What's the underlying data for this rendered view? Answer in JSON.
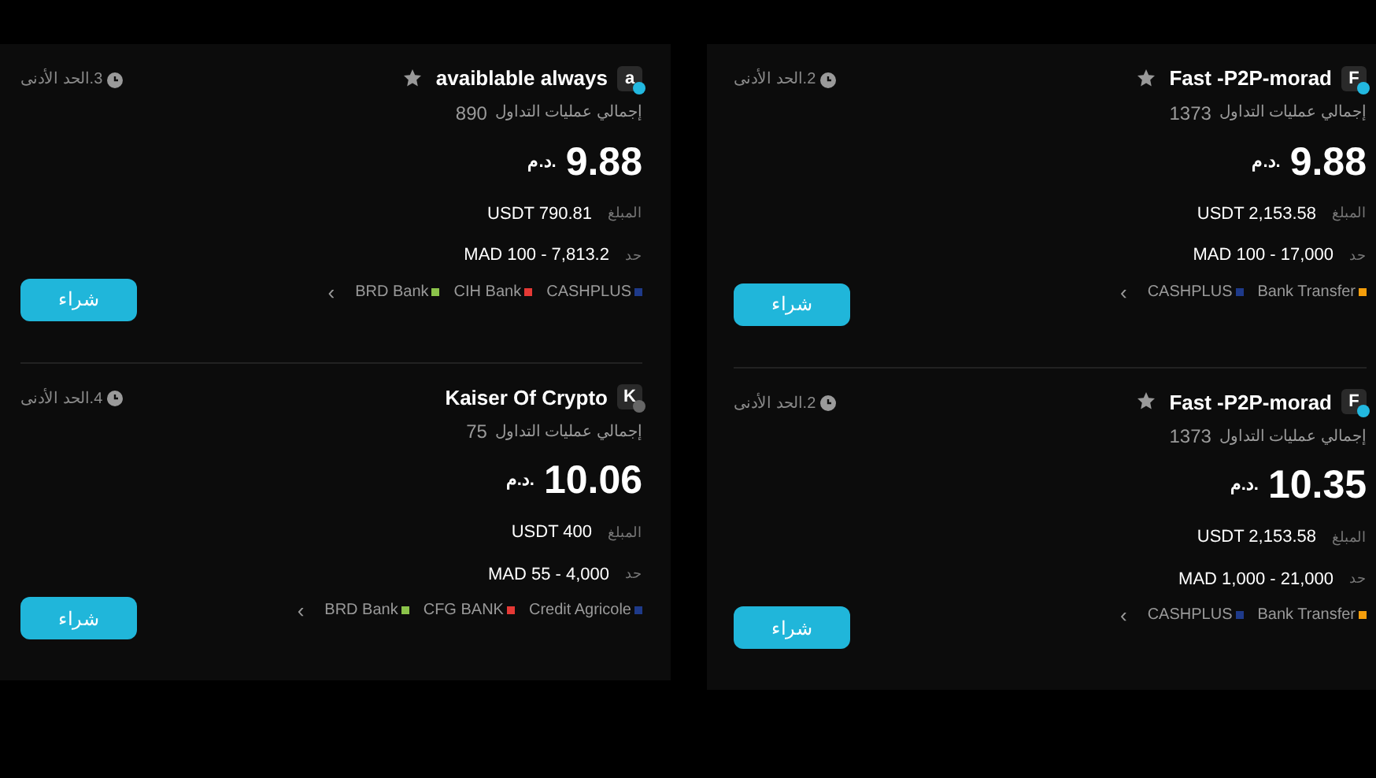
{
  "panels": [
    {
      "cards": [
        {
          "avatar": "F",
          "online": true,
          "badge": true,
          "name": "Fast -P2P-morad",
          "trades_label": "إجمالي عمليات التداول",
          "trades": "1373",
          "price": "9.88",
          "currency": "د.م.",
          "amount_label": "المبلغ",
          "amount": "USDT 2,153.58",
          "limit_label": "حد",
          "limit": "MAD 100 - 17,000",
          "methods": [
            {
              "name": "Bank Transfer",
              "color": "#f59e0b"
            },
            {
              "name": "CASHPLUS",
              "color": "#1e3a8a"
            }
          ],
          "more": "‹",
          "time": "2.الحد الأدنى",
          "button": "شراء"
        },
        {
          "avatar": "F",
          "online": true,
          "badge": true,
          "name": "Fast -P2P-morad",
          "trades_label": "إجمالي عمليات التداول",
          "trades": "1373",
          "price": "10.35",
          "currency": "د.م.",
          "amount_label": "المبلغ",
          "amount": "USDT 2,153.58",
          "limit_label": "حد",
          "limit": "MAD 1,000 - 21,000",
          "methods": [
            {
              "name": "Bank Transfer",
              "color": "#f59e0b"
            },
            {
              "name": "CASHPLUS",
              "color": "#1e3a8a"
            }
          ],
          "more": "‹",
          "time": "2.الحد الأدنى",
          "button": "شراء"
        }
      ]
    },
    {
      "cards": [
        {
          "avatar": "a",
          "online": true,
          "badge": true,
          "name": "avaiblable always",
          "trades_label": "إجمالي عمليات التداول",
          "trades": "890",
          "price": "9.88",
          "currency": "د.م.",
          "amount_label": "المبلغ",
          "amount": "USDT 790.81",
          "limit_label": "حد",
          "limit": "MAD 100 - 7,813.2",
          "methods": [
            {
              "name": "CASHPLUS",
              "color": "#1e3a8a"
            },
            {
              "name": "CIH Bank",
              "color": "#e53935"
            },
            {
              "name": "BRD Bank",
              "color": "#8bc34a"
            }
          ],
          "more": "‹",
          "time": "3.الحد الأدنى",
          "button": "شراء"
        },
        {
          "avatar": "K",
          "online": false,
          "badge": false,
          "name": "Kaiser Of Crypto",
          "trades_label": "إجمالي عمليات التداول",
          "trades": "75",
          "price": "10.06",
          "currency": "د.م.",
          "amount_label": "المبلغ",
          "amount": "USDT 400",
          "limit_label": "حد",
          "limit": "MAD 55 - 4,000",
          "methods": [
            {
              "name": "Credit Agricole",
              "color": "#1e3a8a"
            },
            {
              "name": "CFG BANK",
              "color": "#e53935"
            },
            {
              "name": "BRD Bank",
              "color": "#8bc34a"
            }
          ],
          "more": "‹",
          "time": "4.الحد الأدنى",
          "button": "شراء"
        }
      ]
    }
  ]
}
